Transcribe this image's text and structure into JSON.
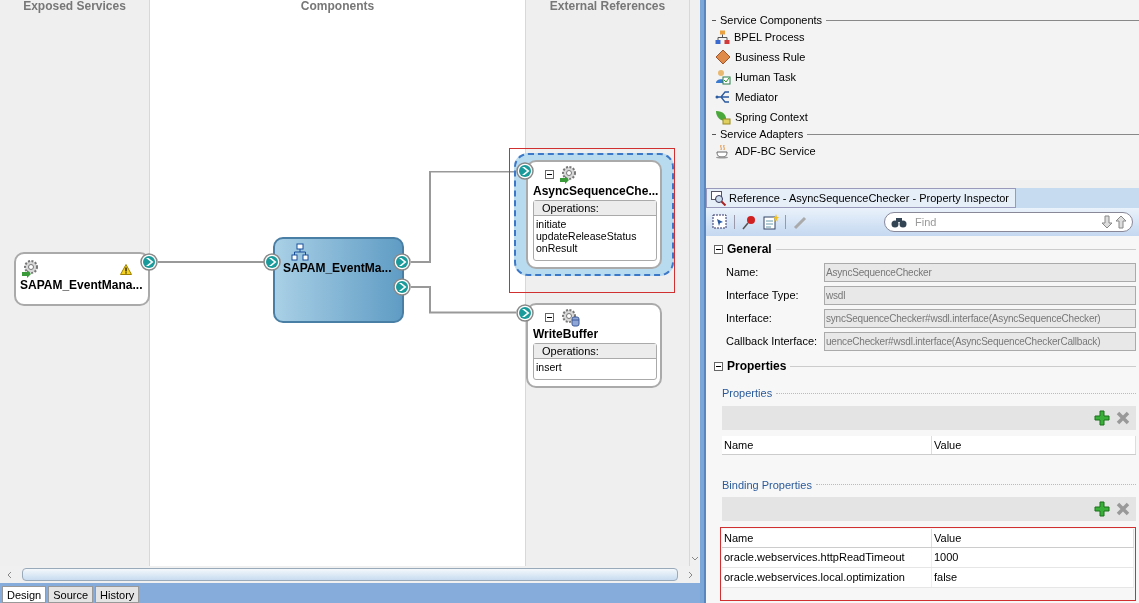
{
  "canvas": {
    "lanes": [
      {
        "title": "Exposed Services"
      },
      {
        "title": "Components"
      },
      {
        "title": "External References"
      }
    ],
    "nodes": [
      {
        "kind": "service",
        "name": "SAPAM_EventMana...",
        "warning": true,
        "selected": false
      },
      {
        "kind": "mediator",
        "name": "SAPAM_EventMa...",
        "selected": false
      },
      {
        "kind": "reference",
        "name": "AsyncSequenceChe...",
        "selected": true,
        "operations_label": "Operations:",
        "operations": [
          "initiate",
          "updateReleaseStatus",
          "onResult"
        ]
      },
      {
        "kind": "reference",
        "name": "WriteBuffer",
        "selected": false,
        "operations_label": "Operations:",
        "operations": [
          "insert"
        ]
      }
    ]
  },
  "editor_tabs": [
    {
      "label": "Design",
      "selected": true
    },
    {
      "label": "Source",
      "selected": false
    },
    {
      "label": "History",
      "selected": false
    }
  ],
  "palette": {
    "sections": [
      {
        "title": "Service Components",
        "items": [
          {
            "kind": "bpel",
            "label": "BPEL Process"
          },
          {
            "kind": "rule",
            "label": "Business Rule"
          },
          {
            "kind": "human",
            "label": "Human Task"
          },
          {
            "kind": "mediator",
            "label": "Mediator"
          },
          {
            "kind": "spring",
            "label": "Spring Context"
          }
        ]
      },
      {
        "title": "Service Adapters",
        "items": [
          {
            "kind": "adfbc",
            "label": "ADF-BC Service"
          }
        ]
      }
    ]
  },
  "inspector": {
    "title": "Reference - AsyncSequenceChecker - Property Inspector",
    "find_placeholder": "Find",
    "general": {
      "title": "General",
      "expanded": true,
      "fields": [
        {
          "label": "Name:",
          "value": "AsyncSequenceChecker"
        },
        {
          "label": "Interface Type:",
          "value": "wsdl"
        },
        {
          "label": "Interface:",
          "value": "syncSequenceChecker#wsdl.interface(AsyncSequenceChecker)"
        },
        {
          "label": "Callback Interface:",
          "value": "uenceChecker#wsdl.interface(AsyncSequenceCheckerCallback)"
        }
      ]
    },
    "properties": {
      "title": "Properties",
      "expanded": true,
      "groups": [
        {
          "title": "Properties",
          "columns": [
            "Name",
            "Value"
          ]
        },
        {
          "title": "Binding Properties",
          "columns": [
            "Name",
            "Value"
          ],
          "rows": [
            [
              "oracle.webservices.httpReadTimeout",
              "1000"
            ],
            [
              "oracle.webservices.local.optimization",
              "false"
            ]
          ]
        }
      ]
    }
  }
}
